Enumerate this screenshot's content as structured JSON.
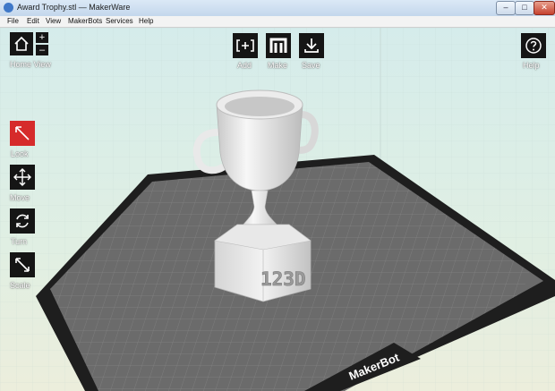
{
  "window": {
    "title": "Award Trophy.stl — MakerWare",
    "min_label": "–",
    "max_label": "□",
    "close_label": "✕"
  },
  "menu": {
    "items": [
      "File",
      "Edit",
      "View",
      "MakerBots",
      "Services",
      "Help"
    ]
  },
  "toolbar": {
    "home_view_label": "Home View",
    "zoom_in_label": "+",
    "zoom_out_label": "–",
    "add_label": "Add",
    "make_label": "Make",
    "save_label": "Save",
    "help_label": "Help"
  },
  "side_tools": {
    "look_label": "Look",
    "move_label": "Move",
    "turn_label": "Turn",
    "scale_label": "Scale"
  },
  "model": {
    "engraving": "123D"
  },
  "platform": {
    "brand": "MakerBot"
  },
  "colors": {
    "look_active": "#d62b2b",
    "tool_bg": "#151515",
    "platform_grid": "#6a6a6a",
    "platform_border": "#1e1e1e"
  },
  "icons": {
    "home": "home-icon",
    "add": "add-plus-icon",
    "make": "makerbot-m-icon",
    "save": "download-icon",
    "help": "question-icon",
    "look": "look-arrow-icon",
    "move": "move-arrows-icon",
    "turn": "rotate-icon",
    "scale": "scale-arrows-icon"
  }
}
